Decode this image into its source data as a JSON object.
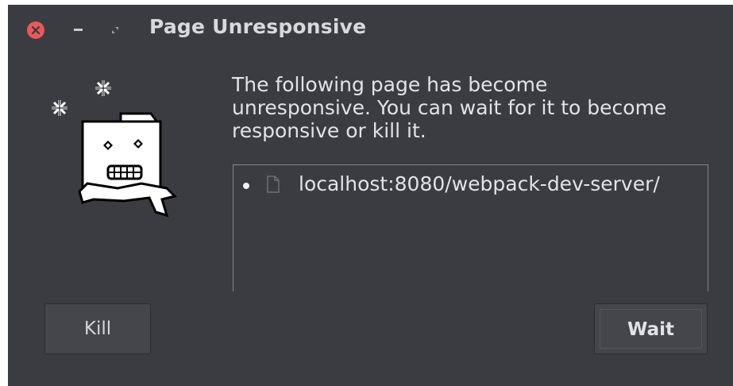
{
  "window": {
    "title": "Page Unresponsive",
    "controls": {
      "close_icon": "close-icon",
      "minimize_icon": "minimize-icon",
      "maximize_icon": "maximize-icon"
    }
  },
  "dialog": {
    "illustration": "frozen-folder-icon",
    "message": "The following page has become unresponsive. You can wait for it to become responsive or kill it.",
    "pages": [
      {
        "icon": "file-icon",
        "url": "localhost:8080/webpack-dev-server/"
      }
    ]
  },
  "buttons": {
    "kill_label": "Kill",
    "wait_label": "Wait"
  },
  "colors": {
    "background": "#3b3c41",
    "close": "#e8595b",
    "text": "#e2e3e6",
    "border": "#86878b"
  }
}
